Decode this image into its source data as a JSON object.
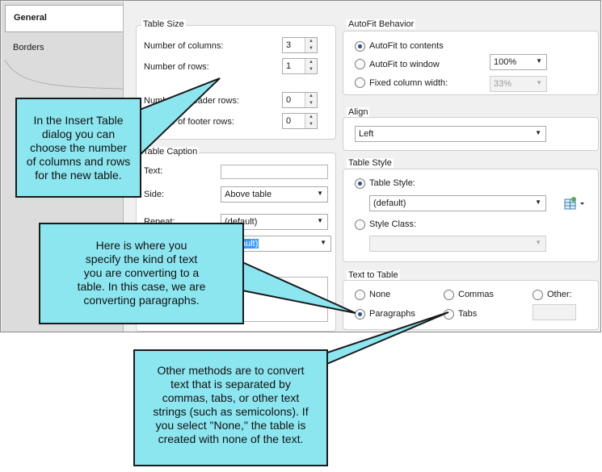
{
  "tabs": [
    {
      "label": "General",
      "active": true
    },
    {
      "label": "Borders",
      "active": false
    }
  ],
  "table_size": {
    "title": "Table Size",
    "columns_label": "Number of columns:",
    "columns_value": "3",
    "rows_label": "Number of rows:",
    "rows_value": "1",
    "header_rows_label": "Number of header rows:",
    "header_rows_value": "0",
    "footer_rows_label": "Number of footer rows:",
    "footer_rows_value": "0"
  },
  "caption": {
    "title": "Table Caption",
    "text_label": "Text:",
    "text_value": "",
    "side_label": "Side:",
    "side_value": "Above table",
    "repeat_label": "Repeat:",
    "repeat_value": "(default)",
    "style_value": "(default)"
  },
  "autofit": {
    "title": "AutoFit Behavior",
    "contents_label": "AutoFit to contents",
    "window_label": "AutoFit to window",
    "window_value": "100%",
    "fixed_label": "Fixed column width:",
    "fixed_value": "33%",
    "selected": "contents"
  },
  "align": {
    "title": "Align",
    "value": "Left"
  },
  "table_style": {
    "title": "Table Style",
    "style_label": "Table Style:",
    "style_value": "(default)",
    "class_label": "Style Class:",
    "class_value": ""
  },
  "text_to_table": {
    "title": "Text to Table",
    "none_label": "None",
    "commas_label": "Commas",
    "other_label": "Other:",
    "paragraphs_label": "Paragraphs",
    "tabs_label": "Tabs",
    "selected": "paragraphs"
  },
  "callouts": {
    "c1": [
      "In the Insert Table",
      "dialog you can",
      "choose the number",
      "of columns and rows",
      "for the new table."
    ],
    "c2": [
      "Here is where you",
      "specify the kind of text",
      "you are converting to a",
      "table. In this case, we are",
      "converting paragraphs."
    ],
    "c3": [
      "Other methods are to convert",
      "text that is separated by",
      "commas, tabs, or other text",
      "strings (such as semicolons). If",
      "you select \"None,\" the table is",
      "created with none of the text."
    ]
  },
  "colors": {
    "callout_fill": "#8ce6f0",
    "selection": "#3399ff",
    "radio_dot": "#2b4e8c"
  }
}
